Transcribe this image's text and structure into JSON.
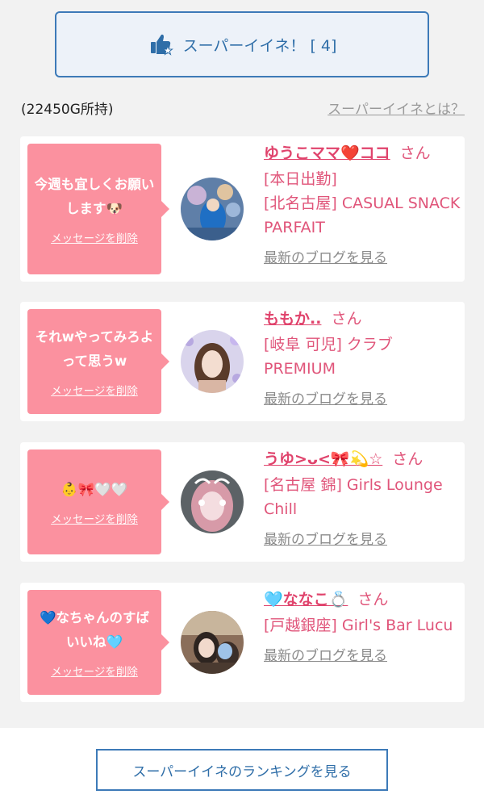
{
  "super_like": {
    "label": "スーパーイイネ！ [ 4]",
    "icon": "thumbs-up-star-icon"
  },
  "points_text": "(22450G所持)",
  "what_is_link": "スーパーイイネとは？",
  "delete_label": "メッセージを削除",
  "blog_label": "最新のブログを見る",
  "san": "さん",
  "cards": [
    {
      "message": "今週も宜しくお願いします🐶",
      "name": "ゆうこママ❤️ココ",
      "line1": "[本日出勤]",
      "line2": "[北名古屋] CASUAL SNACK PARFAIT"
    },
    {
      "message": "それwやってみろよって思うw",
      "name": "ももか..",
      "line1": "[岐阜 可児] クラブ",
      "line2": "PREMIUM"
    },
    {
      "message": "👶🎀🤍🤍",
      "name": "うゆ>ᴗ<🎀💫☆",
      "line1": "[名古屋 錦] Girls Lounge Chill",
      "line2": ""
    },
    {
      "message": "💙なちゃんのすばいいね🩵",
      "name": "🩵ななこ💍",
      "line1": "[戸越銀座] Girl's Bar Lucu",
      "line2": ""
    }
  ],
  "ranking_button": "スーパーイイネのランキングを見る",
  "colors": {
    "accent_blue": "#3d7ab8",
    "bubble_pink": "#fb919f",
    "name_pink": "#e0436c"
  }
}
